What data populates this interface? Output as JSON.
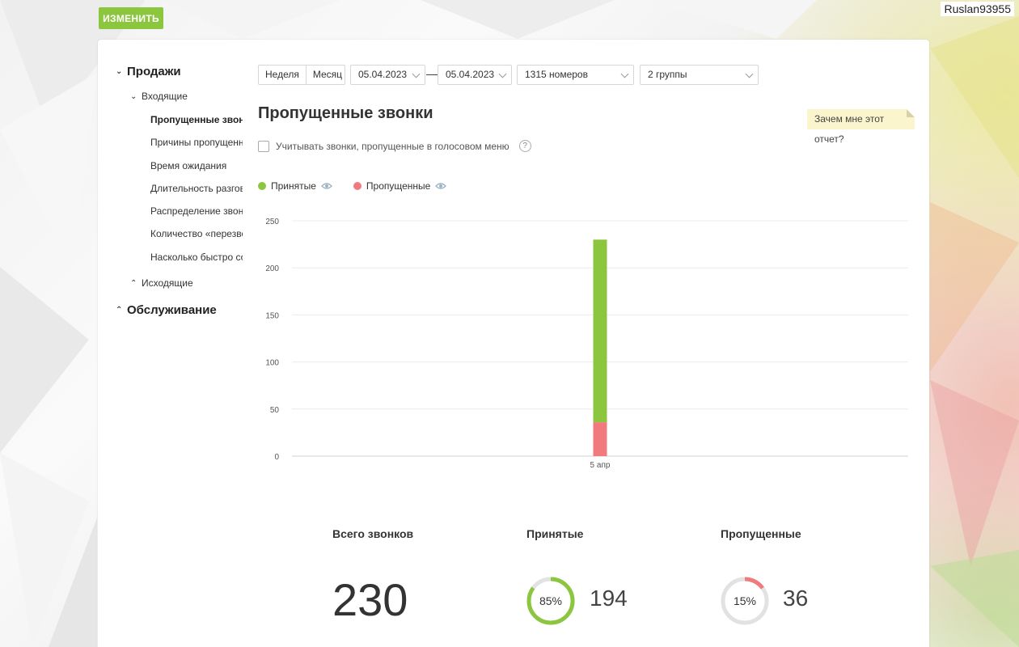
{
  "header": {
    "edit_button": "ИЗМЕНИТЬ",
    "username": "Ruslan93955"
  },
  "sidebar": {
    "sections": [
      {
        "label": "Продажи"
      },
      {
        "label": "Обслуживание"
      }
    ],
    "incoming_label": "Входящие",
    "outgoing_label": "Исходящие",
    "items": [
      {
        "label": "Пропущенные звонки"
      },
      {
        "label": "Причины пропущенных"
      },
      {
        "label": "Время ожидания"
      },
      {
        "label": "Длительность разговора"
      },
      {
        "label": "Распределение звонков"
      },
      {
        "label": "Количество «перезвонов»"
      },
      {
        "label": "Насколько быстро сотрудники"
      }
    ]
  },
  "filters": {
    "week": "Неделя",
    "month": "Месяц",
    "date_from": "05.04.2023",
    "separator": "—",
    "date_to": "05.04.2023",
    "numbers": "1315 номеров",
    "groups": "2 группы"
  },
  "report": {
    "title": "Пропущенные звонки",
    "why_label": "Зачем мне этот отчет?",
    "voice_menu_checkbox": "Учитывать звонки, пропущенные в голосовом меню",
    "help": "?"
  },
  "chart_data": {
    "type": "bar",
    "stacked": true,
    "categories": [
      "5 апр"
    ],
    "series": [
      {
        "name": "Пропущенные",
        "color": "#f07a7e",
        "values": [
          36
        ]
      },
      {
        "name": "Принятые",
        "color": "#8cc63f",
        "values": [
          194
        ]
      }
    ],
    "ylim": [
      0,
      250
    ],
    "yticks": [
      0,
      50,
      100,
      150,
      200,
      250
    ],
    "grid": true,
    "legend_placement": "top-left"
  },
  "stats": {
    "total_label": "Всего звонков",
    "total_value": "230",
    "accepted_label": "Принятые",
    "accepted_percent": "85%",
    "accepted_fraction": 0.85,
    "accepted_value": "194",
    "missed_label": "Пропущенные",
    "missed_percent": "15%",
    "missed_fraction": 0.15,
    "missed_value": "36"
  },
  "colors": {
    "accent_green": "#8cc63f",
    "missed_red": "#f07a7e"
  }
}
